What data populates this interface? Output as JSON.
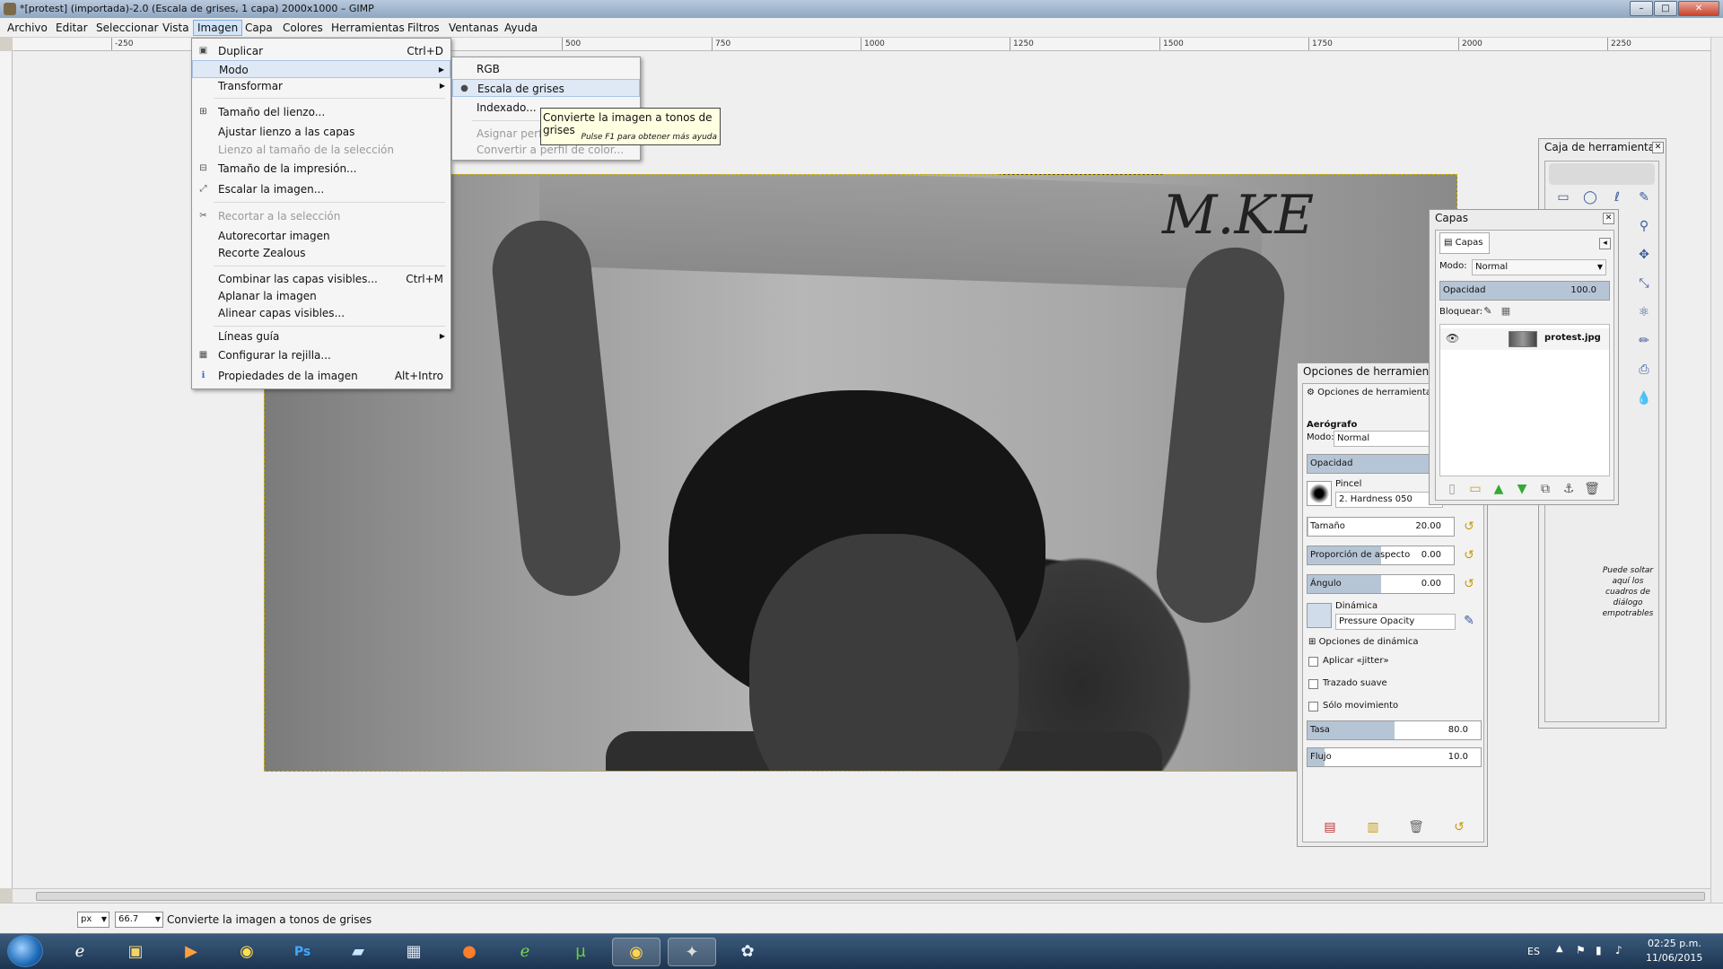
{
  "window": {
    "title": "*[protest] (importada)-2.0 (Escala de grises, 1 capa) 2000x1000 – GIMP",
    "minimize": "–",
    "maximize": "□",
    "close": "✕"
  },
  "menubar": [
    "Archivo",
    "Editar",
    "Seleccionar",
    "Vista",
    "Imagen",
    "Capa",
    "Colores",
    "Herramientas",
    "Filtros",
    "Ventanas",
    "Ayuda"
  ],
  "ruler": {
    "top_labels": [
      "-250",
      "500",
      "750",
      "1000",
      "1250",
      "1500",
      "1750",
      "2000",
      "2250"
    ]
  },
  "image_menu": {
    "items": [
      {
        "label": "Duplicar",
        "shortcut": "Ctrl+D",
        "icon": "duplicate-icon",
        "enabled": true
      },
      {
        "label": "Modo",
        "submenu": true,
        "enabled": true,
        "highlighted": true
      },
      {
        "label": "Transformar",
        "submenu": true,
        "enabled": true
      },
      {
        "label": "Tamaño del lienzo...",
        "icon": "canvas-size-icon",
        "enabled": true
      },
      {
        "label": "Ajustar lienzo a las capas",
        "enabled": true
      },
      {
        "label": "Lienzo al tamaño de la selección",
        "enabled": false
      },
      {
        "label": "Tamaño de la impresión...",
        "icon": "print-size-icon",
        "enabled": true
      },
      {
        "label": "Escalar la imagen...",
        "icon": "scale-icon",
        "enabled": true
      },
      {
        "label": "Recortar a la selección",
        "icon": "crop-icon",
        "enabled": false
      },
      {
        "label": "Autorecortar imagen",
        "enabled": true
      },
      {
        "label": "Recorte Zealous",
        "enabled": true
      },
      {
        "label": "Combinar las capas visibles...",
        "shortcut": "Ctrl+M",
        "enabled": true
      },
      {
        "label": "Aplanar la imagen",
        "enabled": true
      },
      {
        "label": "Alinear capas visibles...",
        "enabled": true
      },
      {
        "label": "Líneas guía",
        "submenu": true,
        "enabled": true
      },
      {
        "label": "Configurar la rejilla...",
        "icon": "grid-icon",
        "enabled": true
      },
      {
        "label": "Propiedades de la imagen",
        "shortcut": "Alt+Intro",
        "icon": "info-icon",
        "enabled": true
      }
    ]
  },
  "mode_submenu": {
    "items": [
      {
        "label": "RGB",
        "enabled": true
      },
      {
        "label": "Escala de grises",
        "enabled": true,
        "selected": true
      },
      {
        "label": "Indexado...",
        "enabled": true
      },
      {
        "label": "Asignar perfil",
        "enabled": false
      },
      {
        "label": "Convertir a perfil de color...",
        "enabled": false
      }
    ]
  },
  "tooltip": {
    "text": "Convierte la imagen a tonos de grises",
    "hint": "Pulse F1 para obtener más ayuda"
  },
  "image": {
    "sign_text": "M.KE"
  },
  "toolbox": {
    "title": "Caja de herramientas",
    "drop_hint": "Puede soltar aquí los cuadros de diálogo empotrables"
  },
  "layers": {
    "title": "Capas",
    "tab": "Capas",
    "mode_label": "Modo:",
    "mode_value": "Normal",
    "opacity_label": "Opacidad",
    "opacity_value": "100.0",
    "opacity_fraction": 1.0,
    "lock_label": "Bloquear:",
    "layer_name": "protest.jpg"
  },
  "tool_options": {
    "title": "Opciones de herramienta",
    "tab": "Opciones de herramienta",
    "tool_name": "Aerógrafo",
    "mode_label": "Modo:",
    "mode_value": "Normal",
    "opacity_label": "Opacidad",
    "brush_label": "Pincel",
    "brush_value": "2. Hardness 050",
    "size_label": "Tamaño",
    "size_value": "20.00",
    "aspect_label": "Proporción de aspecto",
    "aspect_value": "0.00",
    "angle_label": "Ángulo",
    "angle_value": "0.00",
    "dynamics_label": "Dinámica",
    "dynamics_value": "Pressure Opacity",
    "dynamics_options": "Opciones de dinámica",
    "jitter": "Aplicar «jitter»",
    "smooth": "Trazado suave",
    "incremental": "Sólo movimiento",
    "rate_label": "Tasa",
    "rate_value": "80.0",
    "rate_fraction": 0.5,
    "flow_label": "Flujo",
    "flow_value": "10.0",
    "flow_fraction": 0.1
  },
  "status": {
    "unit": "px",
    "zoom": "66.7",
    "message": "Convierte la imagen a tonos de grises"
  },
  "taskbar": {
    "apps": [
      "ie-icon",
      "explorer-icon",
      "media-player-icon",
      "chrome-icon",
      "photoshop-icon",
      "notes-icon",
      "calculator-icon",
      "firefox-icon",
      "editor-icon",
      "utorrent-icon",
      "chrome-canary-icon",
      "gimp-icon",
      "paint-icon"
    ],
    "photoshop_label": "Ps",
    "language": "ES",
    "time": "02:25 p.m.",
    "date": "11/06/2015"
  }
}
